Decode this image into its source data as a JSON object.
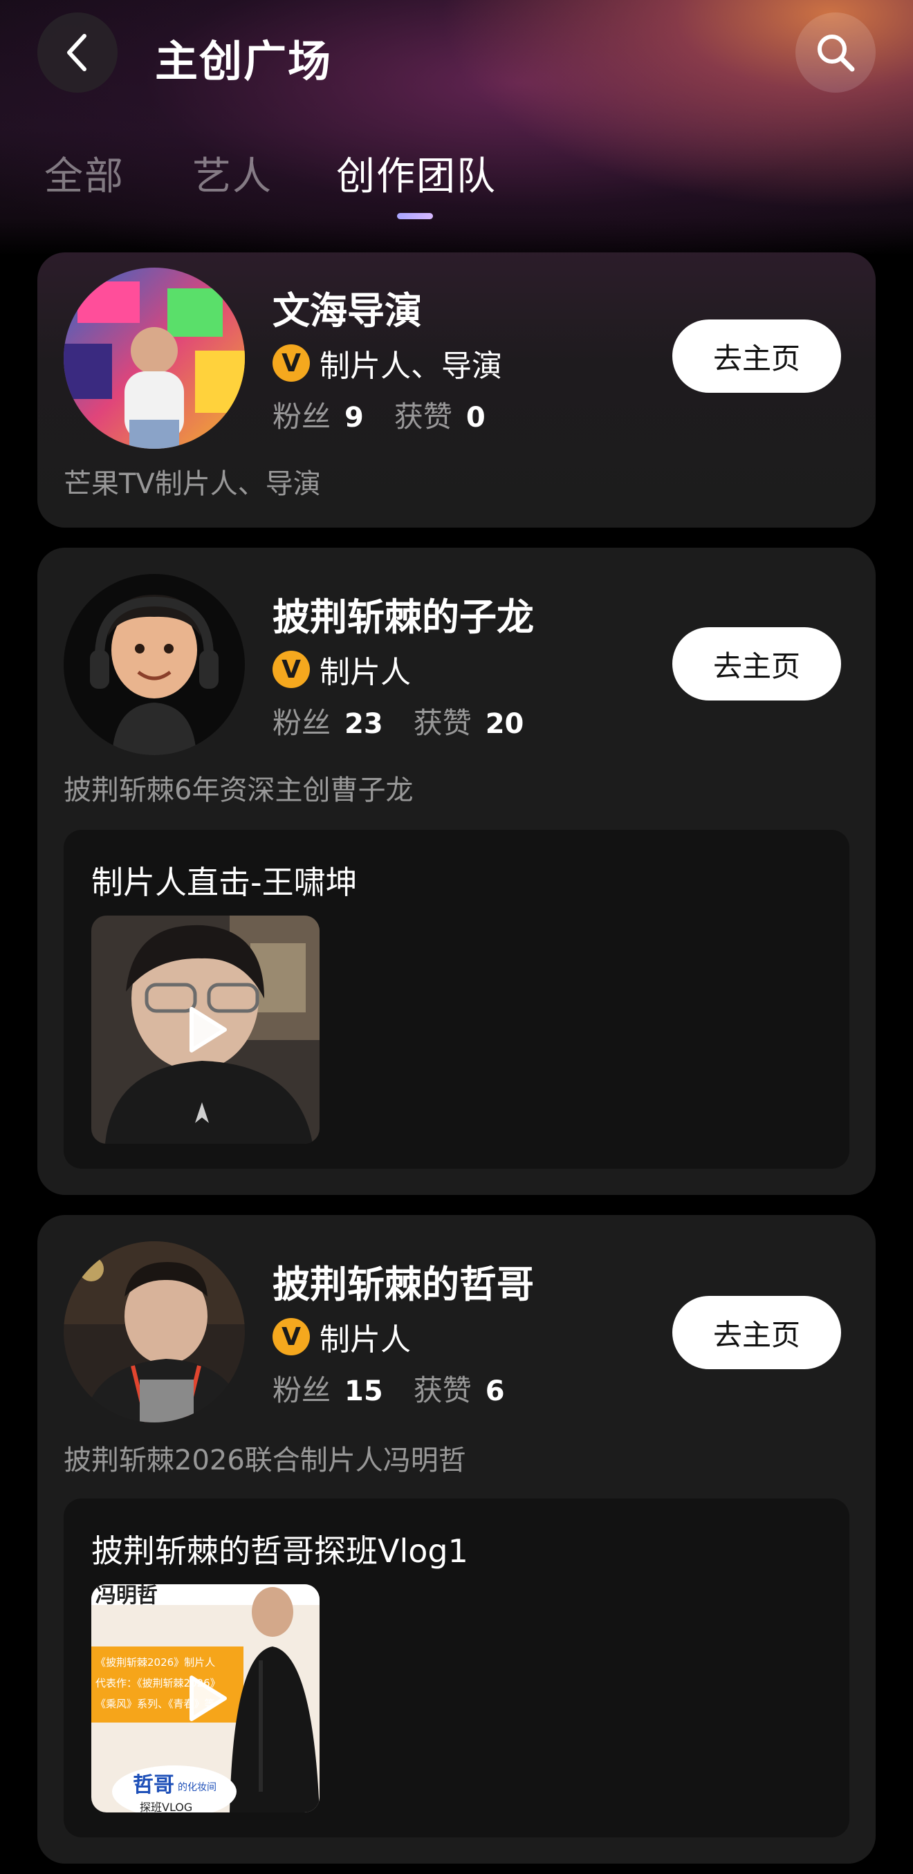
{
  "header": {
    "title": "主创广场"
  },
  "icons": {
    "back": "chevron-left-icon",
    "search": "search-icon",
    "play": "play-icon",
    "verified": "v-badge-icon"
  },
  "tabs": [
    {
      "label": "全部",
      "active": false
    },
    {
      "label": "艺人",
      "active": false
    },
    {
      "label": "创作团队",
      "active": true
    }
  ],
  "colors": {
    "badge": "#f5a81e",
    "tab_indicator": "#b8b0ff",
    "card_bg": "#1c1c1c"
  },
  "creators": [
    {
      "name": "文海导演",
      "badge": "V",
      "roles": "制片人、导演",
      "fans_label": "粉丝",
      "fans": "9",
      "likes_label": "获赞",
      "likes": "0",
      "button": "去主页",
      "bio": "芒果TV制片人、导演"
    },
    {
      "name": "披荆斩棘的子龙",
      "badge": "V",
      "roles": "制片人",
      "fans_label": "粉丝",
      "fans": "23",
      "likes_label": "获赞",
      "likes": "20",
      "button": "去主页",
      "bio": "披荆斩棘6年资深主创曹子龙",
      "video": {
        "title": "制片人直击-王啸坤"
      }
    },
    {
      "name": "披荆斩棘的哲哥",
      "badge": "V",
      "roles": "制片人",
      "fans_label": "粉丝",
      "fans": "15",
      "likes_label": "获赞",
      "likes": "6",
      "button": "去主页",
      "bio": "披荆斩棘2026联合制片人冯明哲",
      "video": {
        "title": "披荆斩棘的哲哥探班Vlog1",
        "thumb_text": {
          "top": "冯明哲",
          "line1": "《披荆斩棘2026》制片人",
          "line2": "代表作：《披荆斩棘2026》",
          "line3": "《乘风》系列、《青春》等",
          "sticker": "哲哥",
          "sticker_sub": "的化妆间",
          "bottom": "探班VLOG"
        }
      }
    }
  ]
}
